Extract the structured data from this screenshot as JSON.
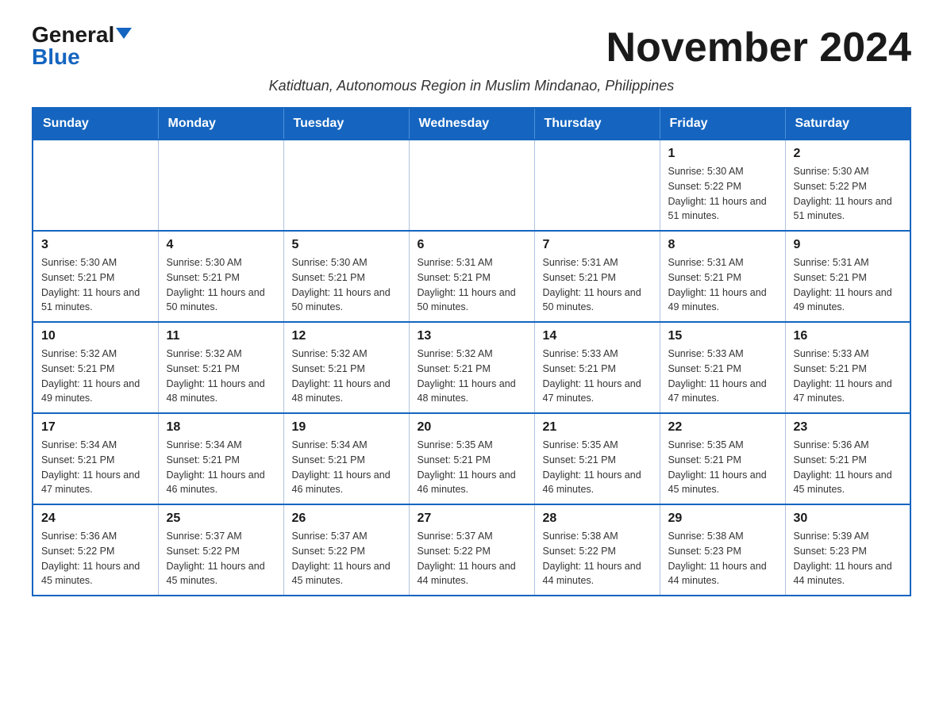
{
  "logo": {
    "general": "General",
    "blue": "Blue"
  },
  "title": "November 2024",
  "subtitle": "Katidtuan, Autonomous Region in Muslim Mindanao, Philippines",
  "weekdays": [
    "Sunday",
    "Monday",
    "Tuesday",
    "Wednesday",
    "Thursday",
    "Friday",
    "Saturday"
  ],
  "weeks": [
    [
      {
        "day": "",
        "info": ""
      },
      {
        "day": "",
        "info": ""
      },
      {
        "day": "",
        "info": ""
      },
      {
        "day": "",
        "info": ""
      },
      {
        "day": "",
        "info": ""
      },
      {
        "day": "1",
        "info": "Sunrise: 5:30 AM\nSunset: 5:22 PM\nDaylight: 11 hours and 51 minutes."
      },
      {
        "day": "2",
        "info": "Sunrise: 5:30 AM\nSunset: 5:22 PM\nDaylight: 11 hours and 51 minutes."
      }
    ],
    [
      {
        "day": "3",
        "info": "Sunrise: 5:30 AM\nSunset: 5:21 PM\nDaylight: 11 hours and 51 minutes."
      },
      {
        "day": "4",
        "info": "Sunrise: 5:30 AM\nSunset: 5:21 PM\nDaylight: 11 hours and 50 minutes."
      },
      {
        "day": "5",
        "info": "Sunrise: 5:30 AM\nSunset: 5:21 PM\nDaylight: 11 hours and 50 minutes."
      },
      {
        "day": "6",
        "info": "Sunrise: 5:31 AM\nSunset: 5:21 PM\nDaylight: 11 hours and 50 minutes."
      },
      {
        "day": "7",
        "info": "Sunrise: 5:31 AM\nSunset: 5:21 PM\nDaylight: 11 hours and 50 minutes."
      },
      {
        "day": "8",
        "info": "Sunrise: 5:31 AM\nSunset: 5:21 PM\nDaylight: 11 hours and 49 minutes."
      },
      {
        "day": "9",
        "info": "Sunrise: 5:31 AM\nSunset: 5:21 PM\nDaylight: 11 hours and 49 minutes."
      }
    ],
    [
      {
        "day": "10",
        "info": "Sunrise: 5:32 AM\nSunset: 5:21 PM\nDaylight: 11 hours and 49 minutes."
      },
      {
        "day": "11",
        "info": "Sunrise: 5:32 AM\nSunset: 5:21 PM\nDaylight: 11 hours and 48 minutes."
      },
      {
        "day": "12",
        "info": "Sunrise: 5:32 AM\nSunset: 5:21 PM\nDaylight: 11 hours and 48 minutes."
      },
      {
        "day": "13",
        "info": "Sunrise: 5:32 AM\nSunset: 5:21 PM\nDaylight: 11 hours and 48 minutes."
      },
      {
        "day": "14",
        "info": "Sunrise: 5:33 AM\nSunset: 5:21 PM\nDaylight: 11 hours and 47 minutes."
      },
      {
        "day": "15",
        "info": "Sunrise: 5:33 AM\nSunset: 5:21 PM\nDaylight: 11 hours and 47 minutes."
      },
      {
        "day": "16",
        "info": "Sunrise: 5:33 AM\nSunset: 5:21 PM\nDaylight: 11 hours and 47 minutes."
      }
    ],
    [
      {
        "day": "17",
        "info": "Sunrise: 5:34 AM\nSunset: 5:21 PM\nDaylight: 11 hours and 47 minutes."
      },
      {
        "day": "18",
        "info": "Sunrise: 5:34 AM\nSunset: 5:21 PM\nDaylight: 11 hours and 46 minutes."
      },
      {
        "day": "19",
        "info": "Sunrise: 5:34 AM\nSunset: 5:21 PM\nDaylight: 11 hours and 46 minutes."
      },
      {
        "day": "20",
        "info": "Sunrise: 5:35 AM\nSunset: 5:21 PM\nDaylight: 11 hours and 46 minutes."
      },
      {
        "day": "21",
        "info": "Sunrise: 5:35 AM\nSunset: 5:21 PM\nDaylight: 11 hours and 46 minutes."
      },
      {
        "day": "22",
        "info": "Sunrise: 5:35 AM\nSunset: 5:21 PM\nDaylight: 11 hours and 45 minutes."
      },
      {
        "day": "23",
        "info": "Sunrise: 5:36 AM\nSunset: 5:21 PM\nDaylight: 11 hours and 45 minutes."
      }
    ],
    [
      {
        "day": "24",
        "info": "Sunrise: 5:36 AM\nSunset: 5:22 PM\nDaylight: 11 hours and 45 minutes."
      },
      {
        "day": "25",
        "info": "Sunrise: 5:37 AM\nSunset: 5:22 PM\nDaylight: 11 hours and 45 minutes."
      },
      {
        "day": "26",
        "info": "Sunrise: 5:37 AM\nSunset: 5:22 PM\nDaylight: 11 hours and 45 minutes."
      },
      {
        "day": "27",
        "info": "Sunrise: 5:37 AM\nSunset: 5:22 PM\nDaylight: 11 hours and 44 minutes."
      },
      {
        "day": "28",
        "info": "Sunrise: 5:38 AM\nSunset: 5:22 PM\nDaylight: 11 hours and 44 minutes."
      },
      {
        "day": "29",
        "info": "Sunrise: 5:38 AM\nSunset: 5:23 PM\nDaylight: 11 hours and 44 minutes."
      },
      {
        "day": "30",
        "info": "Sunrise: 5:39 AM\nSunset: 5:23 PM\nDaylight: 11 hours and 44 minutes."
      }
    ]
  ]
}
